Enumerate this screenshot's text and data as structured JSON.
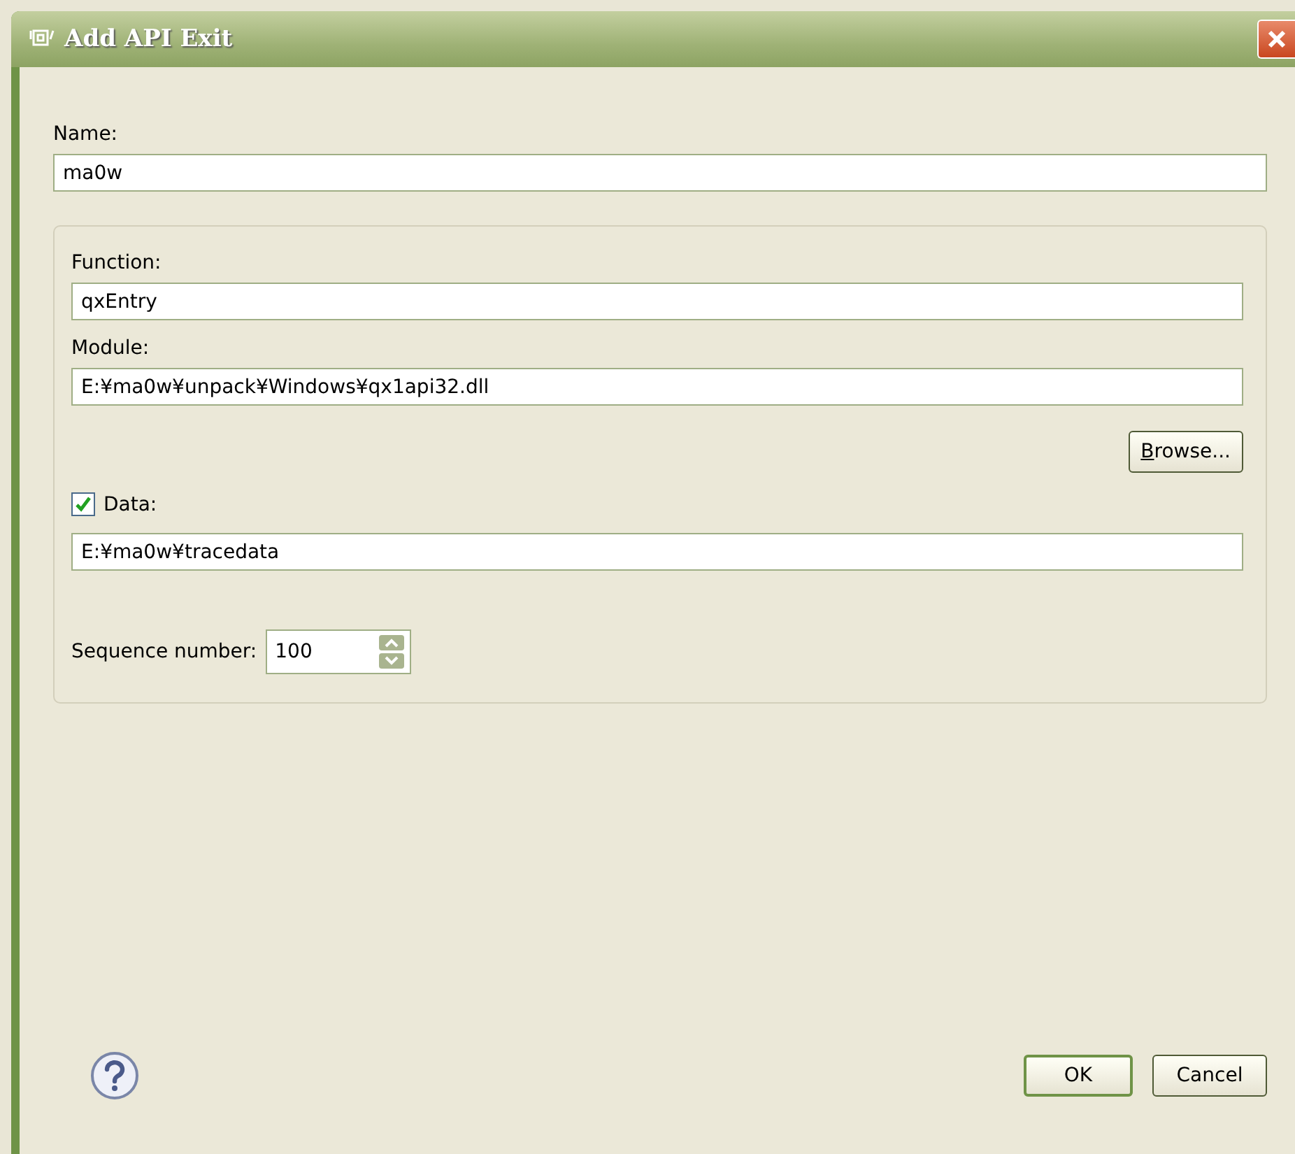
{
  "window": {
    "title": "Add API Exit"
  },
  "name_field": {
    "label": "Name:",
    "value": "ma0w"
  },
  "group": {
    "function": {
      "label": "Function:",
      "value": "qxEntry"
    },
    "module": {
      "label": "Module:",
      "value": "E:¥ma0w¥unpack¥Windows¥qx1api32.dll"
    },
    "browse_button": "Browse...",
    "data": {
      "label": "Data:",
      "checked": true,
      "value": "E:¥ma0w¥tracedata"
    },
    "sequence": {
      "label": "Sequence number:",
      "value": "100"
    }
  },
  "buttons": [
    {
      "label": "OK",
      "selected": true
    },
    {
      "label": "Cancel",
      "selected": false
    }
  ]
}
